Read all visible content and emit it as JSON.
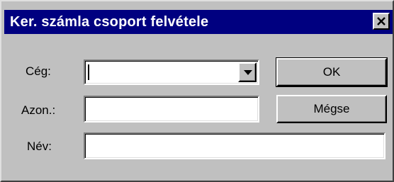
{
  "window": {
    "title": "Ker. számla csoport felvétele",
    "close_glyph": "✕"
  },
  "form": {
    "ceg_label": "Cég:",
    "ceg_value": "",
    "azon_label": "Azon.:",
    "azon_value": "",
    "nev_label": "Név:",
    "nev_value": ""
  },
  "buttons": {
    "ok_label": "OK",
    "cancel_label": "Mégse"
  },
  "colors": {
    "titlebar": "#000080",
    "face": "#c0c0c0",
    "field": "#ffffff"
  }
}
